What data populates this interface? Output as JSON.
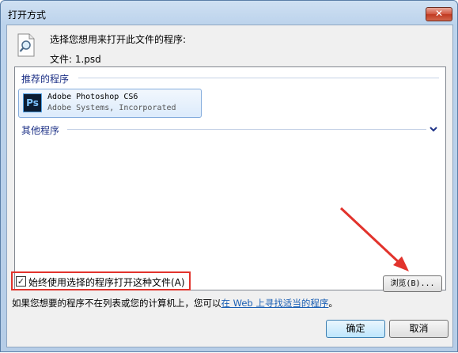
{
  "window": {
    "title": "打开方式",
    "close_label": "✕"
  },
  "header": {
    "prompt": "选择您想用来打开此文件的程序:",
    "file_label": "文件: 1.psd",
    "icon": "search-document-icon"
  },
  "programs": {
    "recommended_header": "推荐的程序",
    "items": [
      {
        "name": "Adobe Photoshop CS6",
        "vendor": "Adobe Systems, Incorporated",
        "icon_text": "Ps",
        "icon": "photoshop-icon"
      }
    ],
    "other_header": "其他程序",
    "expand_icon": "chevron-down-icon"
  },
  "options": {
    "always_use_label": "始终使用选择的程序打开这种文件(A)",
    "always_use_checked": true,
    "browse_label": "浏览(B)...",
    "hint_text": "如果您想要的程序不在列表或您的计算机上，您可以",
    "hint_link": "在 Web 上寻找适当的程序",
    "hint_end": "。"
  },
  "buttons": {
    "ok_label": "确定",
    "cancel_label": "取消"
  },
  "colors": {
    "highlight_box": "#e2332c",
    "annotation_arrow": "#e2332c",
    "link": "#1a5fb4",
    "group_header": "#1e3287"
  }
}
